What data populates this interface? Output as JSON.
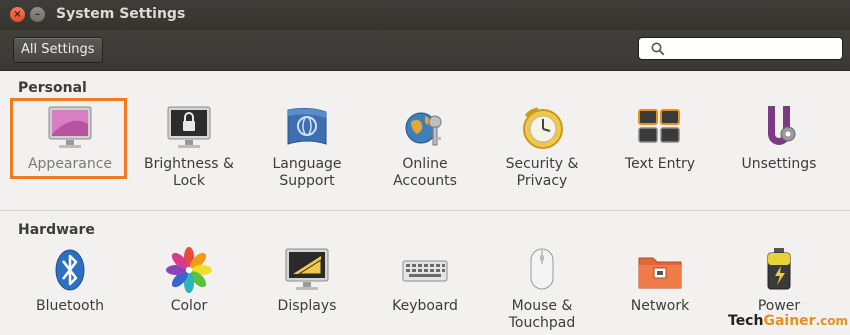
{
  "window": {
    "title": "System Settings"
  },
  "toolbar": {
    "all_settings_label": "All Settings",
    "search_placeholder": ""
  },
  "sections": {
    "personal": {
      "title": "Personal",
      "items": [
        {
          "label": "Appearance",
          "icon": "appearance-icon"
        },
        {
          "label": "Brightness &\nLock",
          "icon": "lock-icon"
        },
        {
          "label": "Language\nSupport",
          "icon": "flag-icon"
        },
        {
          "label": "Online\nAccounts",
          "icon": "online-accounts-icon"
        },
        {
          "label": "Security &\nPrivacy",
          "icon": "security-icon"
        },
        {
          "label": "Text Entry",
          "icon": "text-entry-icon"
        },
        {
          "label": "Unsettings",
          "icon": "unsettings-icon"
        }
      ]
    },
    "hardware": {
      "title": "Hardware",
      "items": [
        {
          "label": "Bluetooth",
          "icon": "bluetooth-icon"
        },
        {
          "label": "Color",
          "icon": "color-icon"
        },
        {
          "label": "Displays",
          "icon": "display-icon"
        },
        {
          "label": "Keyboard",
          "icon": "keyboard-icon"
        },
        {
          "label": "Mouse &\nTouchpad",
          "icon": "mouse-icon"
        },
        {
          "label": "Network",
          "icon": "network-icon"
        },
        {
          "label": "Power",
          "icon": "power-icon"
        }
      ]
    }
  },
  "watermark": {
    "part1": "Tech",
    "part2": "Gainer",
    "part3": ".com"
  },
  "colors": {
    "highlight": "#f07a1f",
    "titlebar": "#3c3b37",
    "accent": "#e6911e"
  }
}
